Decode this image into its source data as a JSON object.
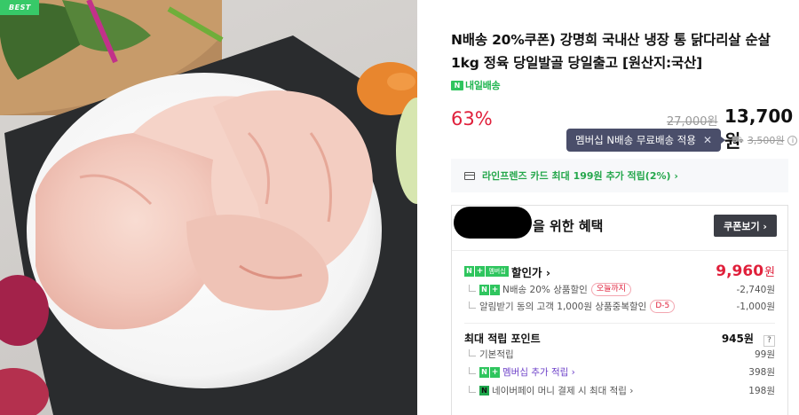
{
  "image": {
    "badge": "BEST",
    "alt_icon": "raw-chicken-thigh-photo"
  },
  "product": {
    "title": "N배송 20%쿠폰) 강명희 국내산 냉장 통 닭다리살 순살 1kg 정육 당일발골 당일출고 [원산지:국산]",
    "delivery_badge_icon": "N",
    "delivery_badge": "내일배송",
    "discount_rate": "63%",
    "original_price": "27,000원",
    "sale_price": "13,700원"
  },
  "shipping": {
    "tooltip": "멤버십 N배송 무료배송 적용",
    "tooltip_close": "✕",
    "truck_icon": "⛟",
    "fee": "3,500원",
    "info_icon": "i"
  },
  "card_promo": {
    "text": "라인프렌즈 카드 최대 199원 추가 적립(2%) ›"
  },
  "benefits": {
    "title": "을 위한 혜택",
    "coupon_button": "쿠폰보기 ›",
    "discount": {
      "label": "할인가 ›",
      "badge_n": "N",
      "badge_plus": "+",
      "badge_member": "멤버십",
      "final_price": "9,960",
      "won": "원"
    },
    "discount_items": [
      {
        "label": "N배송 20% 상품할인",
        "pill": "오늘까지",
        "amount": "-2,740원"
      },
      {
        "label": "알림받기 동의 고객 1,000원 상품중복할인",
        "pill": "D-5",
        "amount": "-1,000원"
      }
    ],
    "points": {
      "label": "최대 적립 포인트",
      "total": "945원",
      "help": "?",
      "items": [
        {
          "label": "기본적립",
          "amount": "99원"
        },
        {
          "label": "멤버십 추가 적립 ›",
          "amount": "398원"
        },
        {
          "label": "네이버페이 머니 결제 시 최대 적립 ›",
          "amount": "198원"
        }
      ]
    }
  }
}
